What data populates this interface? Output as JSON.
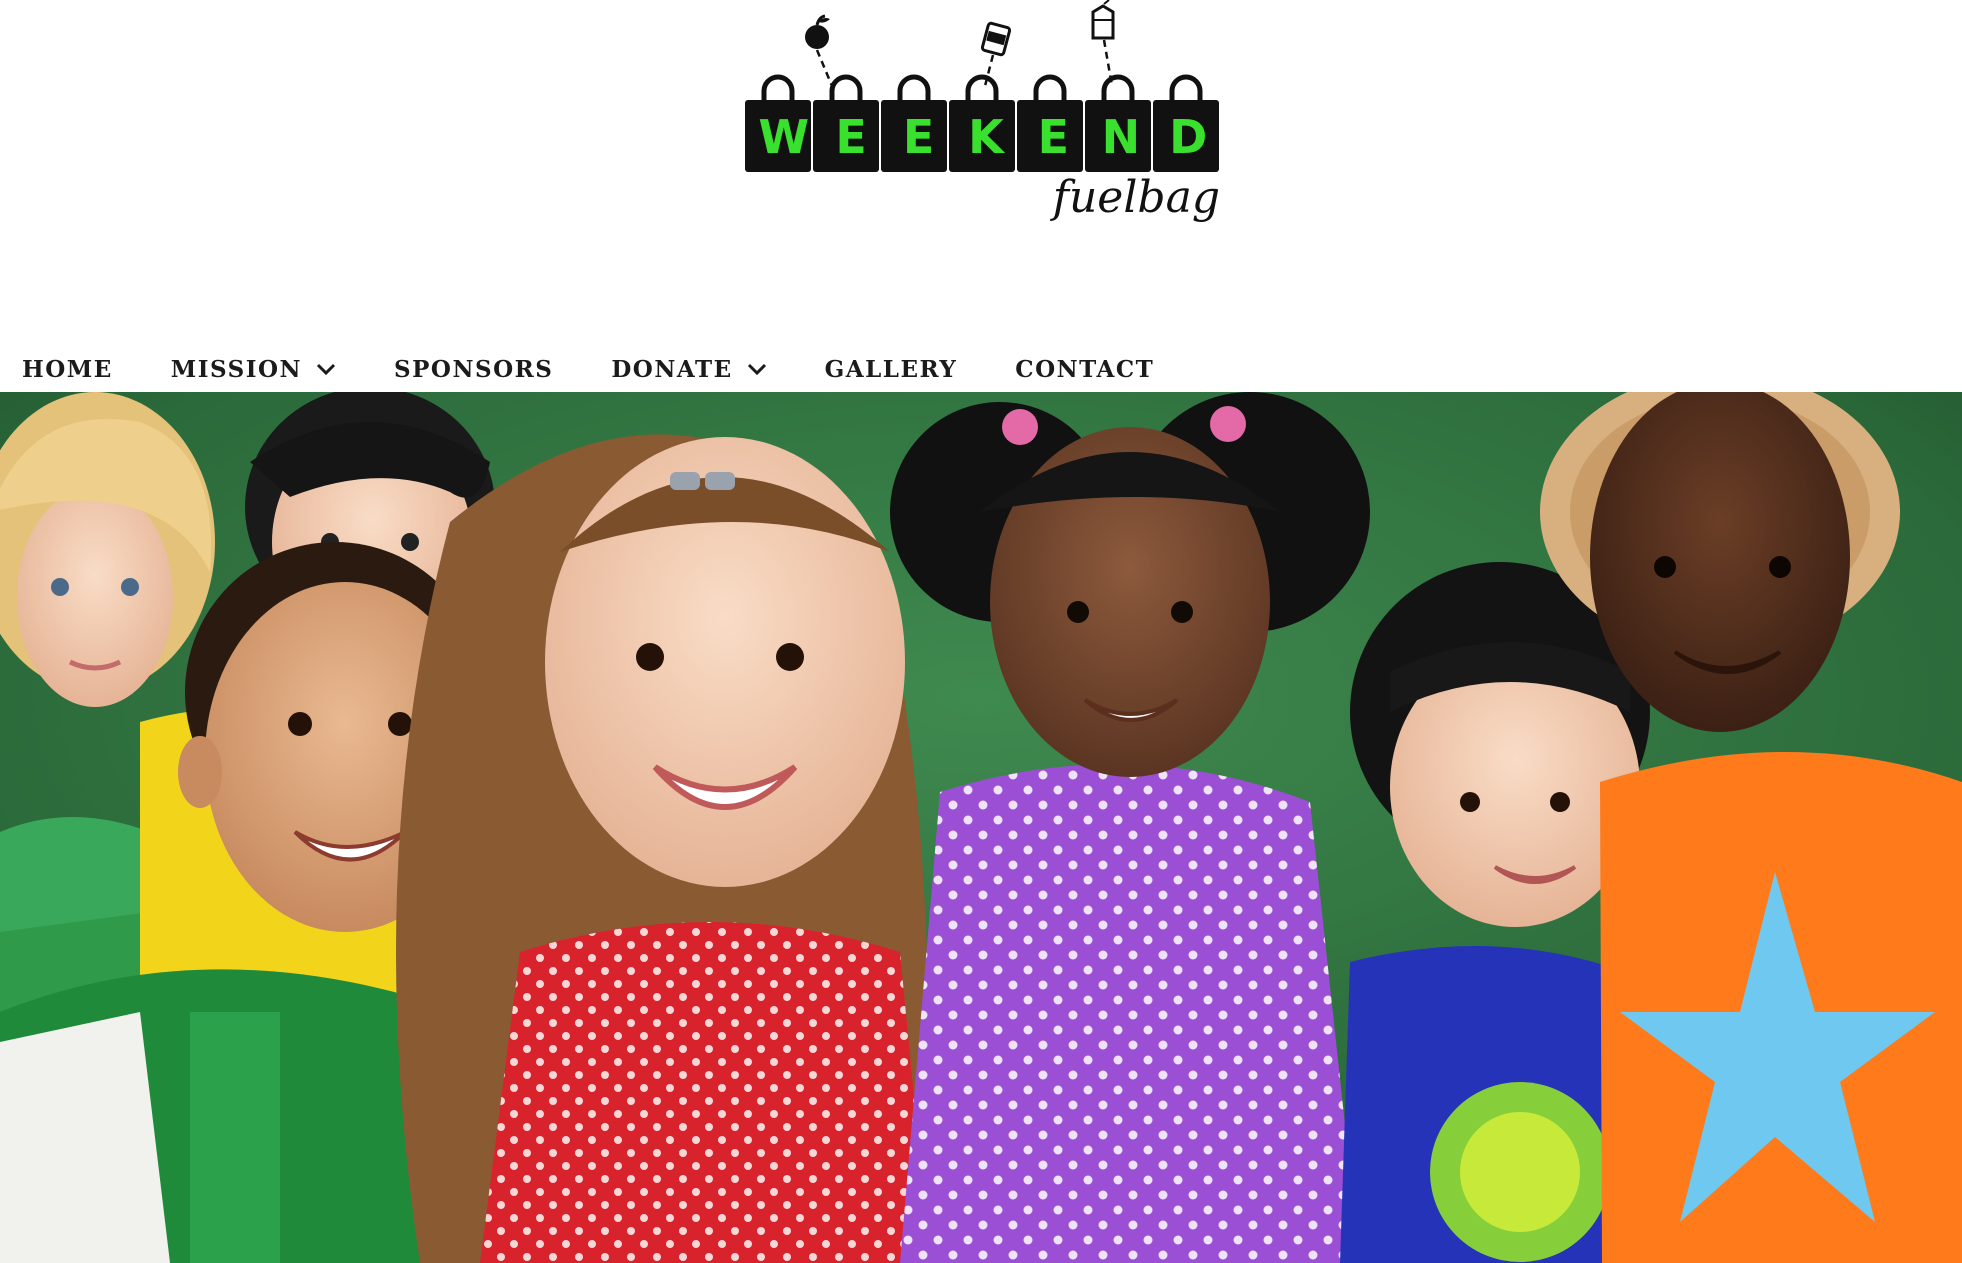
{
  "logo": {
    "letters": [
      "W",
      "E",
      "E",
      "K",
      "E",
      "N",
      "D"
    ],
    "tagline": "fuelbag"
  },
  "nav": {
    "items": [
      {
        "label": "HOME",
        "has_dropdown": false
      },
      {
        "label": "MISSION",
        "has_dropdown": true
      },
      {
        "label": "SPONSORS",
        "has_dropdown": false
      },
      {
        "label": "DONATE",
        "has_dropdown": true
      },
      {
        "label": "GALLERY",
        "has_dropdown": false
      },
      {
        "label": "CONTACT",
        "has_dropdown": false
      }
    ]
  },
  "hero": {
    "image": "group of smiling children in front of a green chalkboard"
  },
  "colors": {
    "logo_green": "#39e02e",
    "logo_black": "#111111",
    "nav_text": "#1b1b1b",
    "chalkboard": "#2f6e3e"
  }
}
